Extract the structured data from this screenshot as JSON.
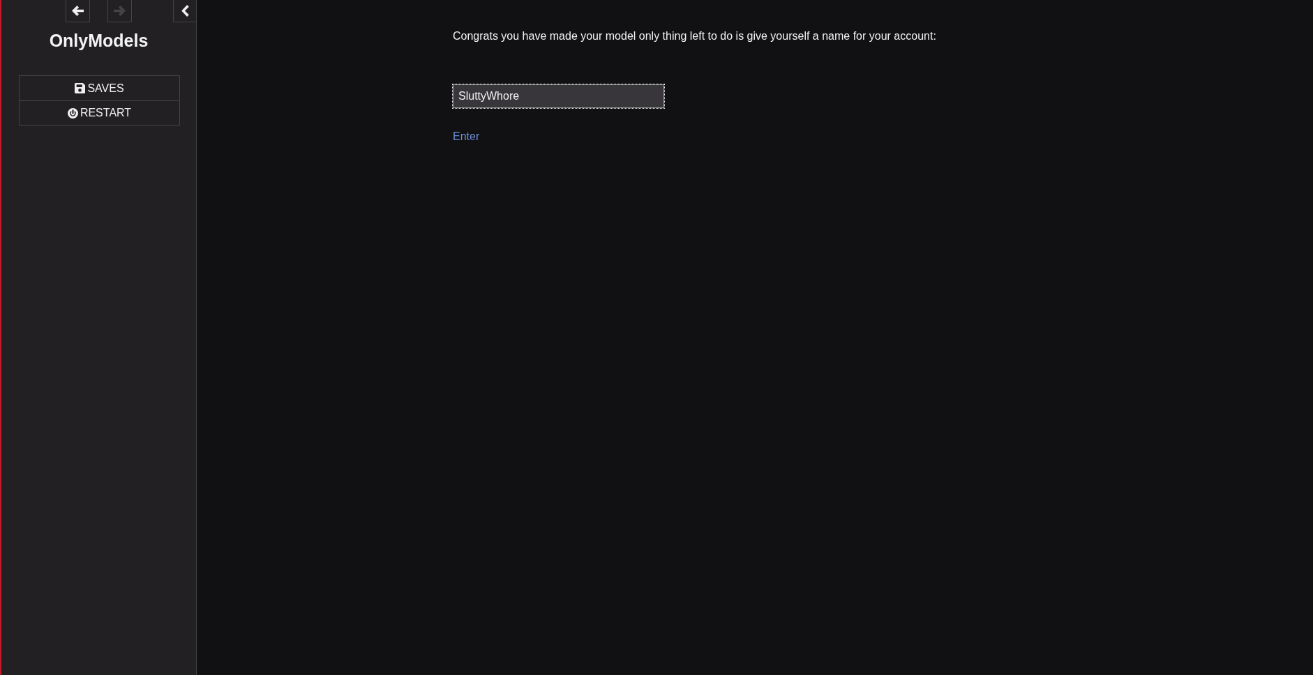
{
  "sidebar": {
    "history": [
      {
        "kind": "back",
        "disabled": false
      },
      {
        "kind": "forward",
        "disabled": true
      }
    ],
    "title": "OnlyModels",
    "menu": [
      {
        "kind": "saves",
        "label": "SAVES"
      },
      {
        "kind": "restart",
        "label": "RESTART"
      }
    ]
  },
  "passage": {
    "text": "Congrats you have made your model only thing left to do is give yourself a name for your account:",
    "name_field": {
      "value": "SluttyWhore",
      "focused": true
    },
    "link": "Enter"
  }
}
